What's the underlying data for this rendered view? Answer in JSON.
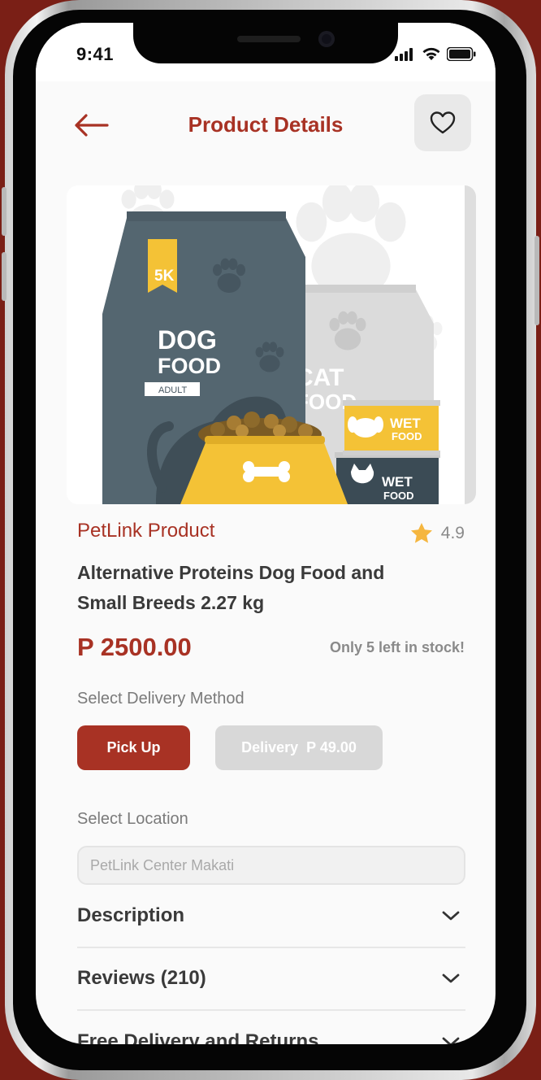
{
  "status_bar": {
    "time": "9:41"
  },
  "header": {
    "title": "Product Details"
  },
  "product": {
    "image_art": {
      "bag_size": "5K",
      "bag_title_line1": "DOG",
      "bag_title_line2": "FOOD",
      "bag_subtitle": "ADULT",
      "back_bag_title_line1": "CAT",
      "back_bag_title_line2": "FOOD",
      "can_label_line1": "WET",
      "can_label_line2": "FOOD"
    },
    "brand": "PetLink Product",
    "rating": "4.9",
    "name": "Alternative Proteins Dog Food and Small Breeds 2.27 kg",
    "price": "P 2500.00",
    "stock_note": "Only 5 left in stock!"
  },
  "delivery": {
    "label": "Select Delivery Method",
    "options": [
      {
        "label": "Pick Up",
        "selected": true
      },
      {
        "label": "Delivery  P 49.00",
        "selected": false
      }
    ]
  },
  "location": {
    "label": "Select Location",
    "placeholder": "PetLink Center Makati",
    "value": ""
  },
  "sections": [
    {
      "label": "Description"
    },
    {
      "label": "Reviews (210)"
    },
    {
      "label": "Free Delivery and Returns"
    }
  ],
  "colors": {
    "accent": "#a83224",
    "frame_bg": "#7a1f16",
    "star": "#f5b63f",
    "disabled": "#d8d8d8"
  },
  "icons": [
    "back-arrow-icon",
    "heart-icon",
    "star-icon",
    "chevron-down-icon",
    "signal-icon",
    "wifi-icon",
    "battery-icon"
  ]
}
